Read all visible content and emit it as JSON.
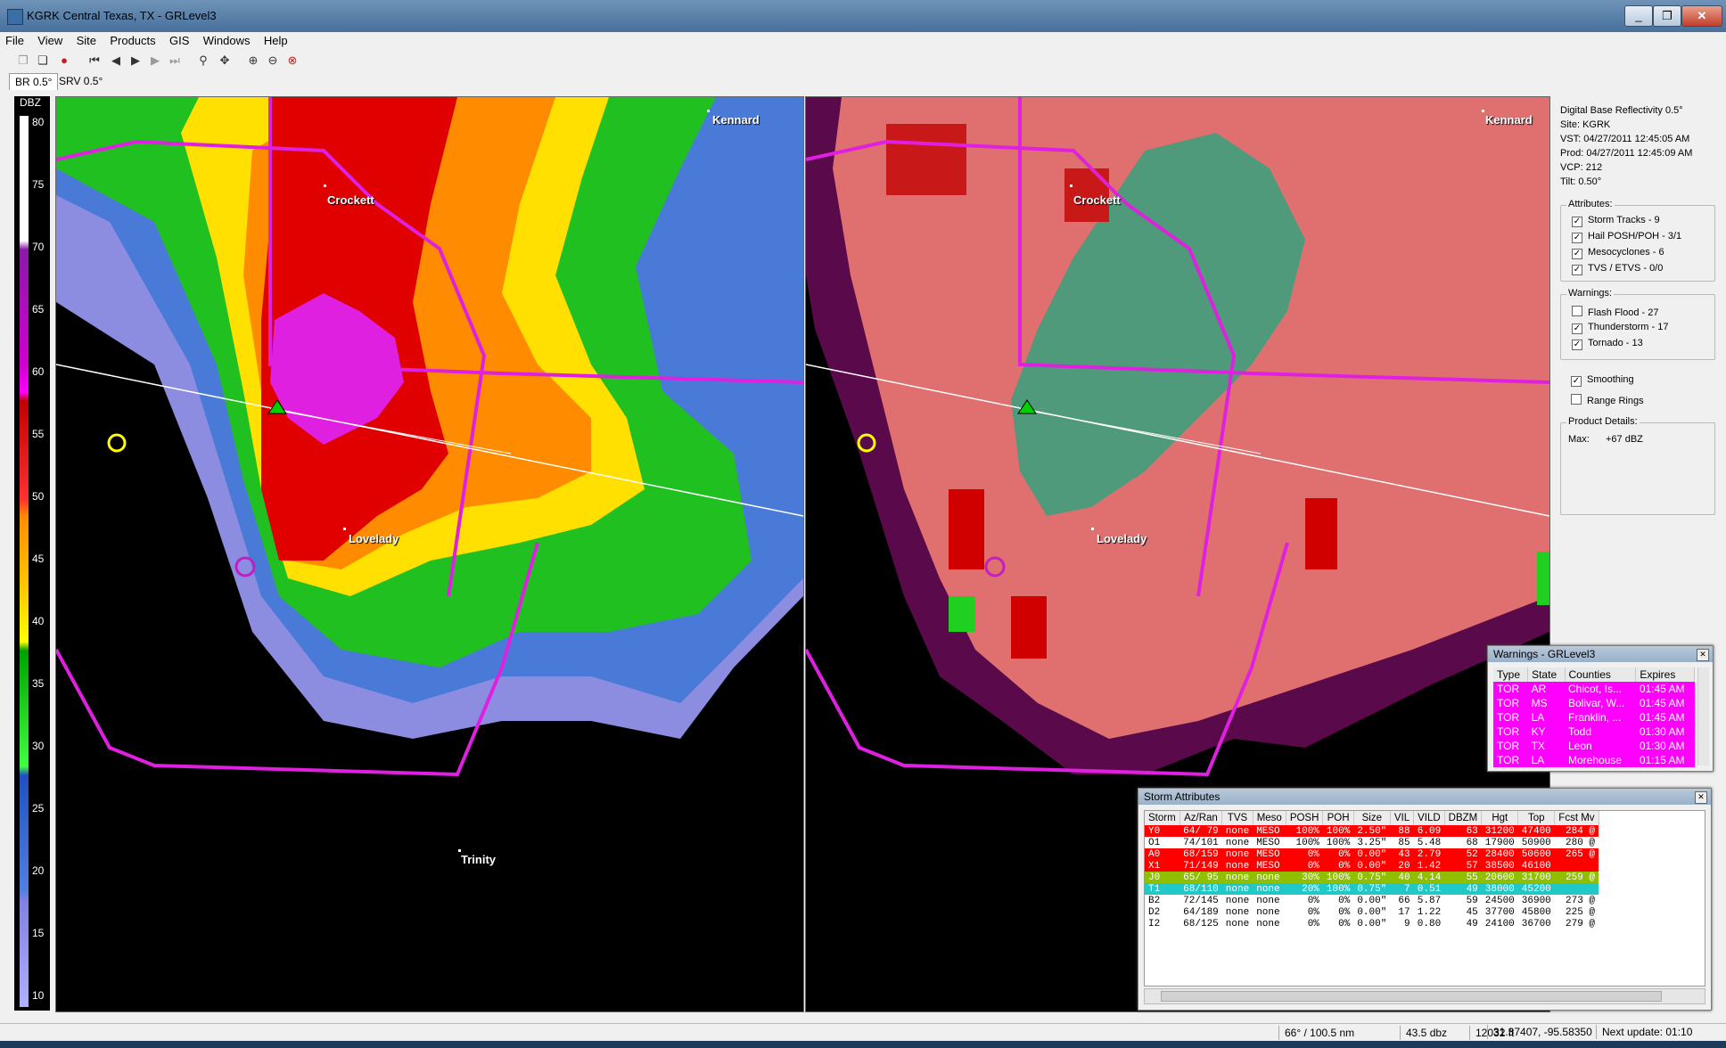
{
  "window": {
    "title": "KGRK Central Texas, TX - GRLevel3",
    "minimize": "_",
    "restore": "❐",
    "close": "✕"
  },
  "menu": [
    "File",
    "View",
    "Site",
    "Products",
    "GIS",
    "Windows",
    "Help"
  ],
  "tabs": [
    "BR 0.5°",
    "SRV 0.5°"
  ],
  "legend": {
    "title": "DBZ",
    "ticks": [
      "80",
      "75",
      "70",
      "65",
      "60",
      "55",
      "50",
      "45",
      "40",
      "35",
      "30",
      "25",
      "20",
      "15",
      "10"
    ]
  },
  "cities": {
    "kennard": "Kennard",
    "crockett": "Crockett",
    "lovelady": "Lovelady",
    "trinity": "Trinity"
  },
  "product": {
    "name": "Digital Base Reflectivity 0.5°",
    "site": "Site:  KGRK",
    "vst": "VST:  04/27/2011  12:45:05 AM",
    "prod": "Prod: 04/27/2011  12:45:09 AM",
    "vcp": "VCP:  212",
    "tilt": "Tilt:    0.50°"
  },
  "attributes": {
    "label": "Attributes:",
    "items": [
      "Storm Tracks - 9",
      "Hail POSH/POH - 3/1",
      "Mesocyclones - 6",
      "TVS / ETVS - 0/0"
    ]
  },
  "warnings_filter": {
    "label": "Warnings:",
    "items": [
      {
        "label": "Flash Flood - 27",
        "checked": false
      },
      {
        "label": "Thunderstorm - 17",
        "checked": true
      },
      {
        "label": "Tornado - 13",
        "checked": true
      }
    ]
  },
  "options": {
    "smoothing": "Smoothing",
    "range_rings": "Range Rings"
  },
  "product_details": {
    "label": "Product Details:",
    "max_label": "Max:",
    "max_value": "+67 dBZ"
  },
  "warnings_window": {
    "title": "Warnings - GRLevel3",
    "columns": [
      "Type",
      "State",
      "Counties",
      "Expires"
    ],
    "rows": [
      [
        "TOR",
        "AR",
        "Chicot, Is...",
        "01:45 AM"
      ],
      [
        "TOR",
        "MS",
        "Bolivar, W...",
        "01:45 AM"
      ],
      [
        "TOR",
        "LA",
        "Franklin, ...",
        "01:45 AM"
      ],
      [
        "TOR",
        "KY",
        "Todd",
        "01:30 AM"
      ],
      [
        "TOR",
        "TX",
        "Leon",
        "01:30 AM"
      ],
      [
        "TOR",
        "LA",
        "Morehouse",
        "01:15 AM"
      ]
    ]
  },
  "storm_window": {
    "title": "Storm Attributes",
    "columns": [
      "Storm",
      "Az/Ran",
      "TVS",
      "Meso",
      "POSH",
      "POH",
      "Size",
      "VIL",
      "VILD",
      "DBZM",
      "Hgt",
      "Top",
      "Fcst Mv"
    ],
    "rows": [
      {
        "cells": [
          "Y0",
          "64/ 79",
          "none",
          "MESO",
          "100%",
          "100%",
          "2.50\"",
          "88",
          "6.09",
          "63",
          "31200",
          "47400",
          "284 @"
        ],
        "color": "red"
      },
      {
        "cells": [
          "O1",
          "74/101",
          "none",
          "MESO",
          "100%",
          "100%",
          "3.25\"",
          "85",
          "5.48",
          "68",
          "17900",
          "50900",
          "280 @"
        ],
        "color": "none"
      },
      {
        "cells": [
          "A0",
          "68/159",
          "none",
          "MESO",
          "0%",
          "0%",
          "0.00\"",
          "43",
          "2.79",
          "52",
          "28400",
          "50600",
          "265 @"
        ],
        "color": "red"
      },
      {
        "cells": [
          "X1",
          "71/149",
          "none",
          "MESO",
          "0%",
          "0%",
          "0.00\"",
          "20",
          "1.42",
          "57",
          "38500",
          "46100",
          ""
        ],
        "color": "red"
      },
      {
        "cells": [
          "J0",
          "65/ 95",
          "none",
          "none",
          "30%",
          "100%",
          "0.75\"",
          "40",
          "4.14",
          "55",
          "20600",
          "31700",
          "259 @"
        ],
        "color": "green"
      },
      {
        "cells": [
          "T1",
          "68/110",
          "none",
          "none",
          "20%",
          "100%",
          "0.75\"",
          "7",
          "0.51",
          "49",
          "38000",
          "45200",
          ""
        ],
        "color": "cyan"
      },
      {
        "cells": [
          "B2",
          "72/145",
          "none",
          "none",
          "0%",
          "0%",
          "0.00\"",
          "66",
          "5.87",
          "59",
          "24500",
          "36900",
          "273 @"
        ],
        "color": "none"
      },
      {
        "cells": [
          "D2",
          "64/189",
          "none",
          "none",
          "0%",
          "0%",
          "0.00\"",
          "17",
          "1.22",
          "45",
          "37700",
          "45800",
          "225 @"
        ],
        "color": "none"
      },
      {
        "cells": [
          "I2",
          "68/125",
          "none",
          "none",
          "0%",
          "0%",
          "0.00\"",
          "9",
          "0.80",
          "49",
          "24100",
          "36700",
          "279 @"
        ],
        "color": "none"
      }
    ]
  },
  "status": {
    "azran": "66° / 100.5 nm",
    "dbz": "43.5 dbz",
    "height": "12032 ft",
    "coords": "31.37407, -95.58350",
    "next": "Next update: 01:10"
  },
  "colors": {
    "tor_row": "#ff00ff",
    "red_row": "#ff0000",
    "green_row": "#8fbf00",
    "cyan_row": "#20c8c8",
    "county_line": "#e020e0"
  }
}
